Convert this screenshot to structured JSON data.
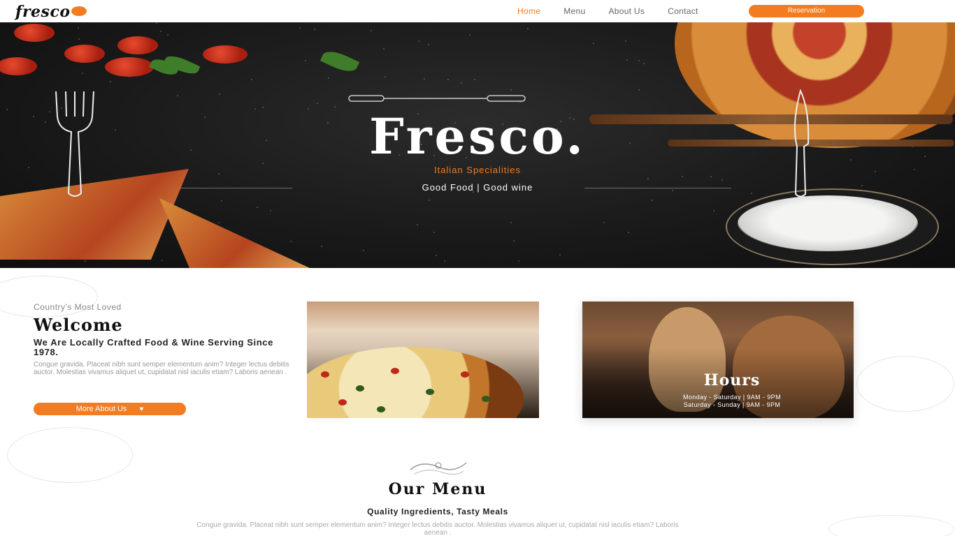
{
  "nav": {
    "logo": "fresco",
    "links": [
      {
        "label": "Home",
        "active": true
      },
      {
        "label": "Menu",
        "active": false
      },
      {
        "label": "About Us",
        "active": false
      },
      {
        "label": "Contact",
        "active": false
      }
    ],
    "reserve_label": "Reservation"
  },
  "hero": {
    "title": "Fresco.",
    "subtitle": "Italian Specialities",
    "tagline": "Good Food | Good wine"
  },
  "welcome": {
    "eyebrow": "Country's Most Loved",
    "title": "Welcome",
    "heading": "We Are Locally Crafted Food & Wine Serving Since 1978.",
    "text": "Congue gravida. Placeat nibh sunt semper elementum anim? Integer lectus debitis auctor. Molestias vivamus aliquet ut, cupidatat nisl iaculis etiam? Laboris aenean .",
    "button": "More About Us"
  },
  "hours": {
    "title": "Hours",
    "lines": [
      "Monday - Saturday | 9AM - 9PM",
      "Saturday - Sunday | 9AM - 9PM"
    ]
  },
  "menu": {
    "title": "Our Menu",
    "subtitle": "Quality Ingredients, Tasty Meals",
    "text": "Congue gravida. Placeat nibh sunt semper elementum anim? Integer lectus debitis auctor. Molestias vivamus aliquet ut, cupidatat nisl iaculis etiam? Laboris aenean ."
  },
  "colors": {
    "accent": "#f47c20",
    "hero_bg": "#1a1a1a"
  }
}
